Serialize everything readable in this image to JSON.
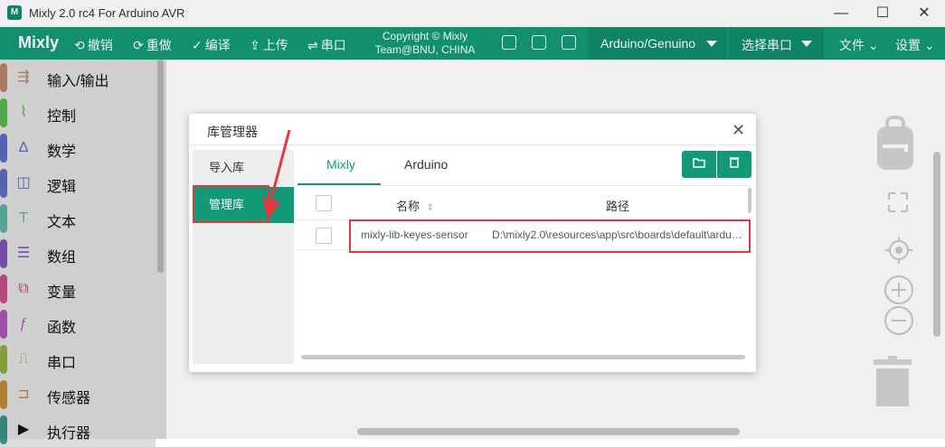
{
  "window": {
    "title": "Mixly 2.0 rc4 For Arduino AVR",
    "controls": [
      "—",
      "☐",
      "✕"
    ]
  },
  "toolbar": {
    "logo": "Mixly",
    "undo": "撤销",
    "redo": "重做",
    "compile": "编译",
    "upload": "上传",
    "serial": "串口",
    "copyright_line1": "Copyright © Mixly",
    "copyright_line2": "Team@BNU, CHINA",
    "board": "Arduino/Genuino",
    "port": "选择串口",
    "file": "文件",
    "settings": "设置"
  },
  "categories": [
    {
      "label": "输入/输出",
      "color": "#b7816a",
      "icon": "⇶"
    },
    {
      "label": "控制",
      "color": "#58b24c",
      "icon": "⌇"
    },
    {
      "label": "数学",
      "color": "#5b6abb",
      "icon": "∆"
    },
    {
      "label": "逻辑",
      "color": "#5b6abb",
      "icon": "◫"
    },
    {
      "label": "文本",
      "color": "#5ab19c",
      "icon": "T"
    },
    {
      "label": "数组",
      "color": "#7b52ad",
      "icon": "☰"
    },
    {
      "label": "变量",
      "color": "#c04e8a",
      "icon": "⧉"
    },
    {
      "label": "函数",
      "color": "#a654b0",
      "icon": "ƒ"
    },
    {
      "label": "串口",
      "color": "#8fa83c",
      "icon": "⎍"
    },
    {
      "label": "传感器",
      "color": "#b98a3a",
      "icon": "⊐"
    },
    {
      "label": "执行器",
      "color": "#3d8e85",
      "icon": "▶"
    }
  ],
  "dialog": {
    "title": "库管理器",
    "nav": [
      "导入库",
      "管理库"
    ],
    "tabs": [
      "Mixly",
      "Arduino"
    ],
    "columns": {
      "name": "名称",
      "path": "路径"
    },
    "rows": [
      {
        "name": "mixly-lib-keyes-sensor",
        "path": "D:\\mixly2.0\\resources\\app\\src\\boards\\default\\ardu…"
      }
    ]
  },
  "colors": {
    "accent": "#129978",
    "highlight": "#e23a3a"
  }
}
